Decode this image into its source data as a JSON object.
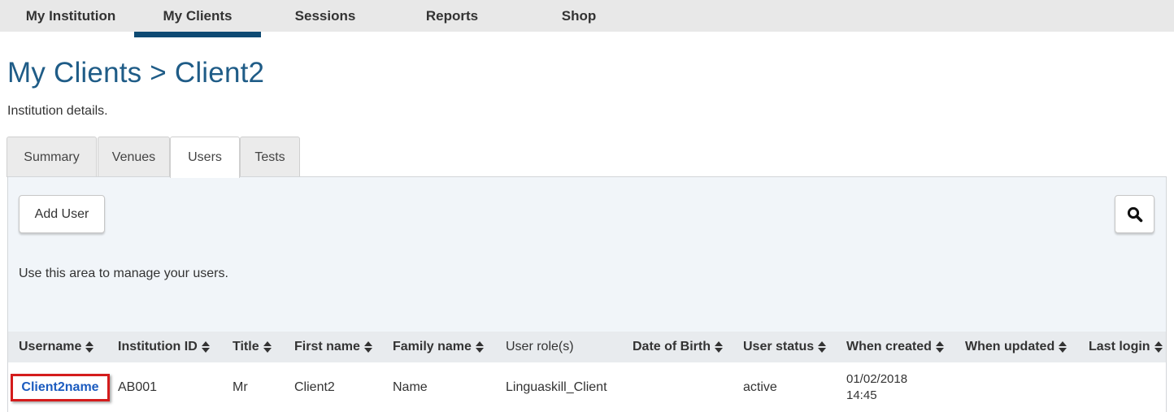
{
  "nav": {
    "items": [
      {
        "label": "My Institution"
      },
      {
        "label": "My Clients"
      },
      {
        "label": "Sessions"
      },
      {
        "label": "Reports"
      },
      {
        "label": "Shop"
      }
    ],
    "active": "My Clients"
  },
  "page": {
    "title": "My Clients > Client2",
    "subtitle": "Institution details."
  },
  "tabs": [
    {
      "label": "Summary"
    },
    {
      "label": "Venues"
    },
    {
      "label": "Users"
    },
    {
      "label": "Tests"
    }
  ],
  "active_tab": "Users",
  "panel": {
    "add_user_label": "Add User",
    "search_icon": "search-icon",
    "note": "Use this area to manage your users."
  },
  "table": {
    "columns": [
      {
        "label": "Username",
        "sortable": true
      },
      {
        "label": "Institution ID",
        "sortable": true
      },
      {
        "label": "Title",
        "sortable": true
      },
      {
        "label": "First name",
        "sortable": true
      },
      {
        "label": "Family name",
        "sortable": true
      },
      {
        "label": "User role(s)",
        "sortable": false
      },
      {
        "label": "Date of Birth",
        "sortable": true
      },
      {
        "label": "User status",
        "sortable": true
      },
      {
        "label": "When created",
        "sortable": true
      },
      {
        "label": "When updated",
        "sortable": true
      },
      {
        "label": "Last login",
        "sortable": true
      }
    ],
    "rows": [
      {
        "username": "Client2name",
        "institution_id": "AB001",
        "title": "Mr",
        "first_name": "Client2",
        "family_name": "Name",
        "user_roles": "Linguaskill_Client",
        "date_of_birth": "",
        "user_status": "active",
        "when_created_date": "01/02/2018",
        "when_created_time": "14:45",
        "when_updated": "",
        "last_login": ""
      }
    ]
  },
  "colors": {
    "nav_bg": "#e8e8e8",
    "nav_active": "#0e4a73",
    "title": "#1f5c87",
    "link": "#1b5bbf",
    "highlight": "#d41c1c",
    "panel_bg": "#f1f5f9"
  }
}
